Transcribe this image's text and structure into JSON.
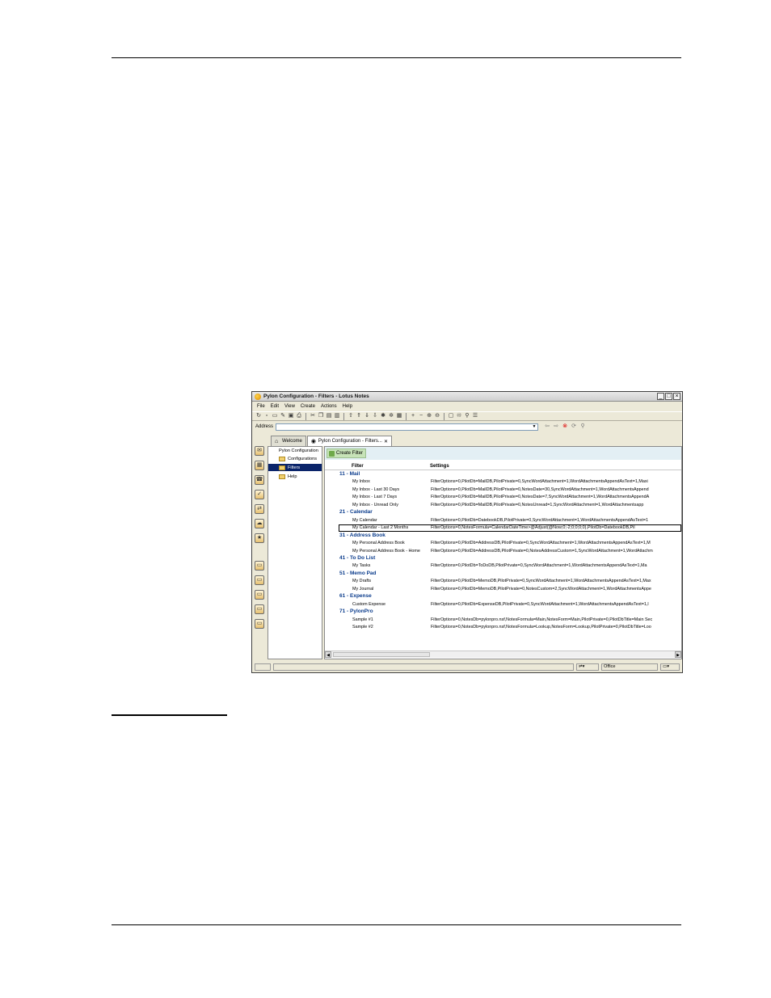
{
  "window": {
    "title": "Pylon Configuration - Filters - Lotus Notes",
    "controls": [
      "_",
      "□",
      "×"
    ]
  },
  "menu": [
    "File",
    "Edit",
    "View",
    "Create",
    "Actions",
    "Help"
  ],
  "address": {
    "label": "Address",
    "value": ""
  },
  "tabs": [
    {
      "label": "Welcome",
      "icon": "home-icon"
    },
    {
      "label": "Pylon Configuration - Filters...",
      "icon": "database-icon"
    }
  ],
  "nav": {
    "root": "Pylon Configuration",
    "items": [
      "Configurations",
      "Filters",
      "Help"
    ],
    "selected": "Filters"
  },
  "actions": {
    "create_filter": "Create Filter"
  },
  "columns": {
    "filter": "Filter",
    "settings": "Settings"
  },
  "rows": [
    {
      "type": "category",
      "label": "11 - Mail"
    },
    {
      "type": "entry",
      "name": "My Inbox",
      "settings": "FilterOptions=0,PilotDb=MailDB,PilotPrivate=0,SyncWordAttachment=1,WordAttachmentsAppendAsText=1,Maxi"
    },
    {
      "type": "entry",
      "name": "My Inbox - Last 30 Days",
      "settings": "FilterOptions=0,PilotDb=MailDB,PilotPrivate=0,NotesDate=30,SyncWordAttachment=1,WordAttachmentsAppend"
    },
    {
      "type": "entry",
      "name": "My Inbox - Last 7 Days",
      "settings": "FilterOptions=0,PilotDb=MailDB,PilotPrivate=0,NotesDate=7,SyncWordAttachment=1,WordAttachmentsAppendA"
    },
    {
      "type": "entry",
      "name": "My Inbox - Unread Only",
      "settings": "FilterOptions=0,PilotDb=MailDB,PilotPrivate=0,NotesUnread=1,SyncWordAttachment=1,WordAttachmentsapp"
    },
    {
      "type": "category",
      "label": "21 - Calendar"
    },
    {
      "type": "entry",
      "name": "My Calendar",
      "settings": "FilterOptions=0,PilotDb=DatebookDB,PilotPrivate=0,SyncWordAttachment=1,WordAttachmentsAppendAsText=1"
    },
    {
      "type": "entry",
      "selected": true,
      "name": "My Calendar - Last 2 Months",
      "settings": "FilterOptions=0,NotesFormula=CalendarDateTime>@Adjust(@Now;0;-2;0;0;0;0),PilotDb=DatebookDB,Pil"
    },
    {
      "type": "category",
      "label": "31 - Address Book"
    },
    {
      "type": "entry",
      "name": "My Personal Address Book",
      "settings": "FilterOptions=0,PilotDb=AddressDB,PilotPrivate=0,SyncWordAttachment=1,WordAttachmentsAppendAsText=1,M"
    },
    {
      "type": "entry",
      "name": "My Personal Address Book - Home",
      "settings": "FilterOptions=0,PilotDb=AddressDB,PilotPrivate=0,NotesAddressCustom=1,SyncWordAttachment=1,WordAttachm"
    },
    {
      "type": "category",
      "label": "41 - To Do List"
    },
    {
      "type": "entry",
      "name": "My Tasks",
      "settings": "FilterOptions=0,PilotDb=ToDoDB,PilotPrivate=0,SyncWordAttachment=1,WordAttachmentsAppendAsText=1,Ma"
    },
    {
      "type": "category",
      "label": "51 - Memo Pad"
    },
    {
      "type": "entry",
      "name": "My Drafts",
      "settings": "FilterOptions=0,PilotDb=MemoDB,PilotPrivate=0,SyncWordAttachment=1,WordAttachmentsAppendAsText=1,Max"
    },
    {
      "type": "entry",
      "name": "My Journal",
      "settings": "FilterOptions=0,PilotDb=MemoDB,PilotPrivate=0,NotesCustom=2,SyncWordAttachment=1,WordAttachmentsAppe"
    },
    {
      "type": "category",
      "label": "61 - Expense"
    },
    {
      "type": "entry",
      "name": "Custom Expense",
      "settings": "FilterOptions=0,PilotDb=ExpenseDB,PilotPrivate=0,SyncWordAttachment=1,WordAttachmentsAppendAsText=1,l"
    },
    {
      "type": "category",
      "label": "71 - PylonPro"
    },
    {
      "type": "entry",
      "name": "Sample #1",
      "settings": "FilterOptions=0,NotesDb=pylonpro.nsf,NotesFormula=Main,NotesForm=Main,PilotPrivate=0,PilotDbTitle=Main Sec"
    },
    {
      "type": "entry",
      "name": "Sample #2",
      "settings": "FilterOptions=0,NotesDb=pylonpro.nsf,NotesFormula=Lookup,NotesForm=Lookup,PilotPrivate=0,PilotDbTitle=Loo"
    }
  ],
  "status": {
    "location": "Office"
  }
}
